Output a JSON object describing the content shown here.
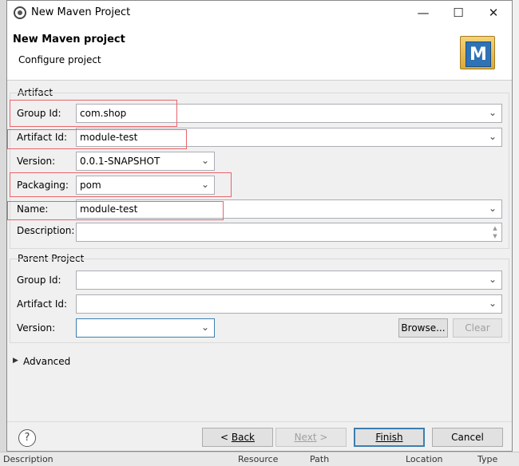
{
  "window": {
    "title": "New Maven Project"
  },
  "header": {
    "title": "New Maven project",
    "subtitle": "Configure project"
  },
  "artifact": {
    "label": "Artifact",
    "group_id": {
      "label": "Group Id:",
      "value": "com.shop"
    },
    "artifact_id": {
      "label": "Artifact Id:",
      "value": "module-test"
    },
    "version": {
      "label": "Version:",
      "value": "0.0.1-SNAPSHOT"
    },
    "packaging": {
      "label": "Packaging:",
      "value": "pom"
    },
    "name": {
      "label": "Name:",
      "value": "module-test"
    },
    "description": {
      "label": "Description:",
      "value": ""
    }
  },
  "parent": {
    "label": "Parent Project",
    "group_id": {
      "label": "Group Id:",
      "value": ""
    },
    "artifact_id": {
      "label": "Artifact Id:",
      "value": ""
    },
    "version": {
      "label": "Version:",
      "value": ""
    },
    "browse_label": "Browse...",
    "clear_label": "Clear"
  },
  "advanced": {
    "label": "Advanced"
  },
  "footer": {
    "back_prefix": "< ",
    "back_label": "Back",
    "next_label": "Next",
    "next_suffix": " >",
    "finish_label": "Finish",
    "cancel_label": "Cancel"
  },
  "background": {
    "bottom_labels": [
      "Description",
      "Resource",
      "Path",
      "Location",
      "Type"
    ]
  },
  "colors": {
    "highlight_box": "#e8646a",
    "focus": "#3c7fb1"
  },
  "icons": [
    "app-icon",
    "minimize-icon",
    "maximize-icon",
    "close-icon",
    "maven-logo",
    "chevron-down-icon",
    "expand-triangle-icon",
    "help-icon"
  ]
}
